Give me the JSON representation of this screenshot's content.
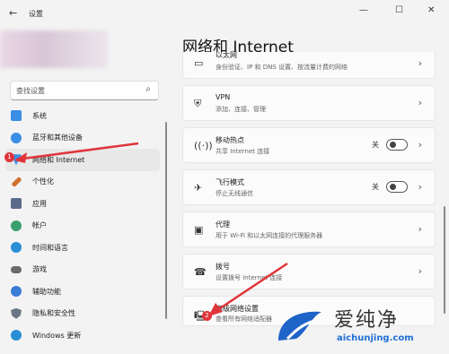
{
  "window": {
    "title": "设置",
    "back": "←",
    "minimize": "—",
    "maximize": "☐",
    "close": "✕"
  },
  "search": {
    "placeholder": "查找设置"
  },
  "sidebar": {
    "items": [
      {
        "label": "系统",
        "icon": "system-icon",
        "color": "#3a8ee6"
      },
      {
        "label": "蓝牙和其他设备",
        "icon": "bluetooth-icon",
        "color": "#3a8ee6"
      },
      {
        "label": "网络和 Internet",
        "icon": "network-icon",
        "color": "#3a8ee6"
      },
      {
        "label": "个性化",
        "icon": "brush-icon",
        "color": "#d07030"
      },
      {
        "label": "应用",
        "icon": "apps-icon",
        "color": "#5a6b8a"
      },
      {
        "label": "帐户",
        "icon": "account-icon",
        "color": "#3aa06e"
      },
      {
        "label": "时间和语言",
        "icon": "globe-time-icon",
        "color": "#2a8ed6"
      },
      {
        "label": "游戏",
        "icon": "game-icon",
        "color": "#6a6a6a"
      },
      {
        "label": "辅助功能",
        "icon": "accessibility-icon",
        "color": "#3a7bd5"
      },
      {
        "label": "隐私和安全性",
        "icon": "shield-icon",
        "color": "#6a7684"
      },
      {
        "label": "Windows 更新",
        "icon": "update-icon",
        "color": "#2a8ed6"
      }
    ],
    "active_index": 2,
    "badge": "1"
  },
  "main": {
    "heading": "网络和 Internet",
    "cards": [
      {
        "title": "以太网",
        "sub": "身份验证、IP 和 DNS 设置、按流量计费的网络"
      },
      {
        "title": "VPN",
        "sub": "添加、连接、管理"
      },
      {
        "title": "移动热点",
        "sub": "共享 Internet 连接",
        "toggle": "关"
      },
      {
        "title": "飞行模式",
        "sub": "停止无线通信",
        "toggle": "关"
      },
      {
        "title": "代理",
        "sub": "用于 Wi-Fi 和以太网连接的代理服务器"
      },
      {
        "title": "拨号",
        "sub": "设置拨号 Internet 连接"
      },
      {
        "title": "高级网络设置",
        "sub": "查看所有网络适配器"
      }
    ],
    "badge": "2"
  },
  "watermark": {
    "text": "爱纯净",
    "url": "aichunjing.com"
  }
}
